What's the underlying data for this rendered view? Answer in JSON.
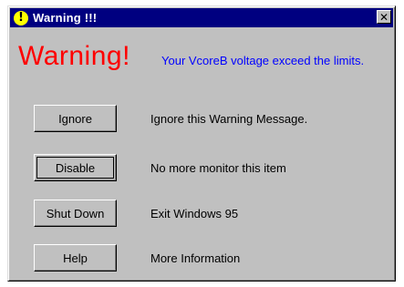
{
  "window": {
    "title": "Warning !!!",
    "close_glyph": "✕"
  },
  "icon": {
    "name": "warning-icon",
    "glyph": "!",
    "color": "#ffff00"
  },
  "headline": "Warning!",
  "message": "Your VcoreB voltage exceed the limits.",
  "actions": [
    {
      "button": "Ignore",
      "description": "Ignore this Warning Message."
    },
    {
      "button": "Disable",
      "description": "No more monitor this item"
    },
    {
      "button": "Shut Down",
      "description": "Exit Windows 95"
    },
    {
      "button": "Help",
      "description": "More Information"
    }
  ],
  "colors": {
    "title_bar": "#000080",
    "headline": "#ff0000",
    "message": "#0000ff",
    "face": "#c0c0c0"
  }
}
